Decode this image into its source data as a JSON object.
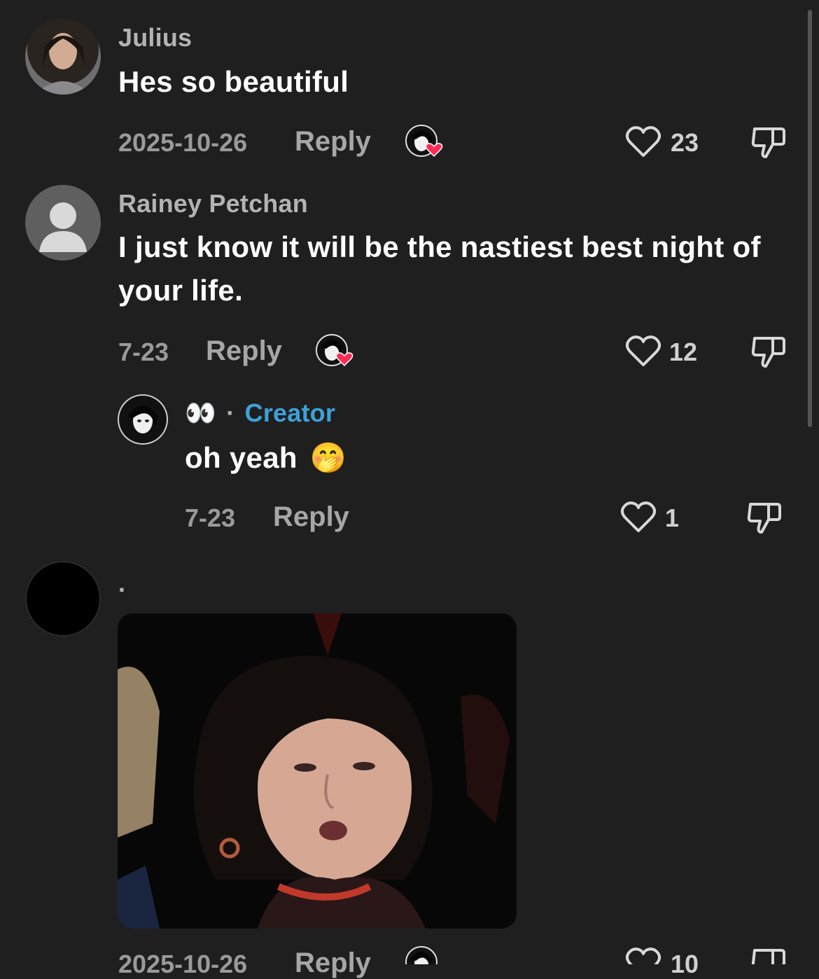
{
  "comments": [
    {
      "username": "Julius",
      "text": "Hes so beautiful",
      "date": "2025-10-26",
      "reply_label": "Reply",
      "likes": "23"
    },
    {
      "username": "Rainey Petchan",
      "text": "I just know it will be the nastiest best night of your life.",
      "date": "7-23",
      "reply_label": "Reply",
      "likes": "12",
      "replies": [
        {
          "username_emoji": "👀",
          "separator": "·",
          "creator_label": "Creator",
          "text": "oh yeah",
          "emoji": "🤭",
          "date": "7-23",
          "reply_label": "Reply",
          "likes": "1"
        }
      ]
    },
    {
      "username": ".",
      "date": "2025-10-26",
      "reply_label": "Reply",
      "likes": "10"
    }
  ],
  "colors": {
    "background": "#1f1f1f",
    "creator": "#3da2d8",
    "liked_heart": "#fe2c55"
  }
}
